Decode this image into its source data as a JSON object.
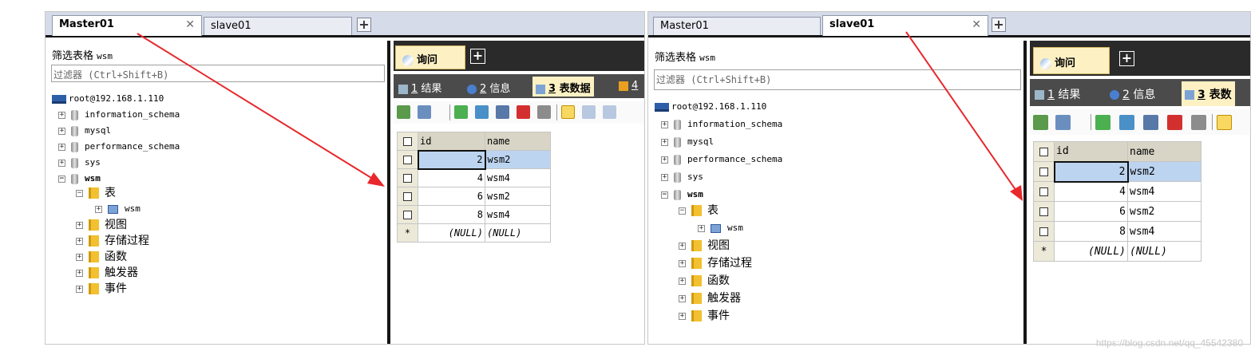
{
  "colors": {
    "accent_arrow": "#e8282c",
    "tabbar": "#d6dbe9",
    "query_tab": "#fdf1c4",
    "dark_bar": "#2a2a2a"
  },
  "panels": [
    {
      "connection_tabs": [
        {
          "label": "Master01",
          "active": true,
          "closable": true
        },
        {
          "label": "slave01",
          "active": false,
          "closable": false
        }
      ],
      "filter": {
        "title": "筛选表格",
        "db": "wsm",
        "placeholder": "过滤器 (Ctrl+Shift+B)"
      },
      "tree": {
        "server": "root@192.168.1.110",
        "databases": [
          "information_schema",
          "mysql",
          "performance_schema",
          "sys",
          "wsm"
        ],
        "folders": {
          "tables": "表",
          "views": "视图",
          "procs": "存储过程",
          "funcs": "函数",
          "triggers": "触发器",
          "events": "事件"
        },
        "table": "wsm"
      },
      "query_tab": "询问",
      "result_tabs": [
        {
          "num": "1",
          "label": "结果"
        },
        {
          "num": "2",
          "label": "信息"
        },
        {
          "num": "3",
          "label": "表数据"
        },
        {
          "num": "4",
          "label": ""
        }
      ],
      "grid": {
        "columns": [
          "id",
          "name"
        ],
        "rows": [
          [
            "2",
            "wsm2"
          ],
          [
            "4",
            "wsm4"
          ],
          [
            "6",
            "wsm2"
          ],
          [
            "8",
            "wsm4"
          ]
        ],
        "null_row": [
          "(NULL)",
          "(NULL)"
        ],
        "new_row_marker": "*"
      }
    },
    {
      "connection_tabs": [
        {
          "label": "Master01",
          "active": false,
          "closable": false
        },
        {
          "label": "slave01",
          "active": true,
          "closable": true
        }
      ],
      "filter": {
        "title": "筛选表格",
        "db": "wsm",
        "placeholder": "过滤器 (Ctrl+Shift+B)"
      },
      "tree": {
        "server": "root@192.168.1.110",
        "databases": [
          "information_schema",
          "mysql",
          "performance_schema",
          "sys",
          "wsm"
        ],
        "folders": {
          "tables": "表",
          "views": "视图",
          "procs": "存储过程",
          "funcs": "函数",
          "triggers": "触发器",
          "events": "事件"
        },
        "table": "wsm"
      },
      "query_tab": "询问",
      "result_tabs": [
        {
          "num": "1",
          "label": "结果"
        },
        {
          "num": "2",
          "label": "信息"
        },
        {
          "num": "3",
          "label": "表数"
        }
      ],
      "grid": {
        "columns": [
          "id",
          "name"
        ],
        "rows": [
          [
            "2",
            "wsm2"
          ],
          [
            "4",
            "wsm4"
          ],
          [
            "6",
            "wsm2"
          ],
          [
            "8",
            "wsm4"
          ]
        ],
        "null_row": [
          "(NULL)",
          "(NULL)"
        ],
        "new_row_marker": "*"
      }
    }
  ],
  "watermark": "https://blog.csdn.net/qq_45542380"
}
